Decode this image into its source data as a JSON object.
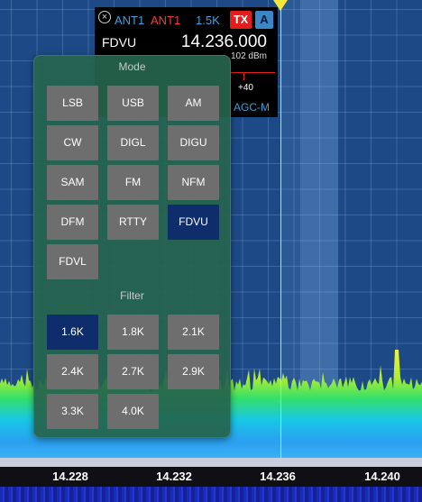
{
  "slice_flag": {
    "rx_antenna": "ANT1",
    "tx_antenna": "ANT1",
    "filter_width": "1.5K",
    "tx_label": "TX",
    "slice_letter": "A",
    "mode": "FDVU",
    "frequency": "14.236.000",
    "signal_level": "102 dBm",
    "s_meter_scale": "+40",
    "agc_label": "AGC-M"
  },
  "popover": {
    "mode_title": "Mode",
    "modes": [
      {
        "label": "LSB",
        "selected": false
      },
      {
        "label": "USB",
        "selected": false
      },
      {
        "label": "AM",
        "selected": false
      },
      {
        "label": "CW",
        "selected": false
      },
      {
        "label": "DIGL",
        "selected": false
      },
      {
        "label": "DIGU",
        "selected": false
      },
      {
        "label": "SAM",
        "selected": false
      },
      {
        "label": "FM",
        "selected": false
      },
      {
        "label": "NFM",
        "selected": false
      },
      {
        "label": "DFM",
        "selected": false
      },
      {
        "label": "RTTY",
        "selected": false
      },
      {
        "label": "FDVU",
        "selected": true
      },
      {
        "label": "FDVL",
        "selected": false
      }
    ],
    "filter_title": "Filter",
    "filters": [
      {
        "label": "1.6K",
        "selected": true
      },
      {
        "label": "1.8K",
        "selected": false
      },
      {
        "label": "2.1K",
        "selected": false
      },
      {
        "label": "2.4K",
        "selected": false
      },
      {
        "label": "2.7K",
        "selected": false
      },
      {
        "label": "2.9K",
        "selected": false
      },
      {
        "label": "3.3K",
        "selected": false
      },
      {
        "label": "4.0K",
        "selected": false
      }
    ]
  },
  "frequency_scale": {
    "labels": [
      "14.228",
      "14.232",
      "14.236",
      "14.240"
    ]
  },
  "colors": {
    "selected_button": "#0f2d6b",
    "button": "#6e6e6e",
    "tx_red": "#e11d1d",
    "rx_blue": "#3d9fdc",
    "center_marker": "#f5e63c"
  }
}
